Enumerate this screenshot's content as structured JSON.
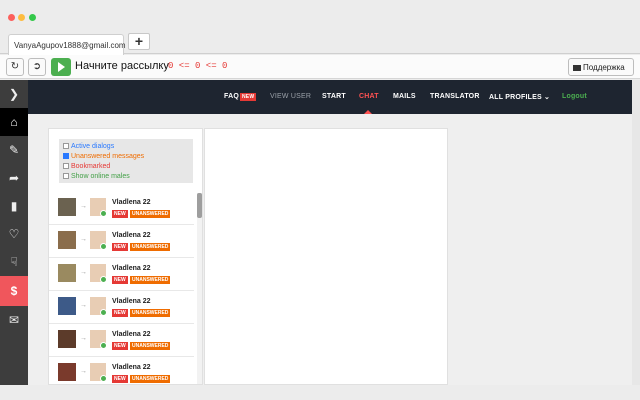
{
  "browser": {
    "tab_title": "VanyaAgupov1888@gmail.com",
    "new_tab_label": "+"
  },
  "toolbar": {
    "start_mailing_label": "Начните рассылку",
    "counter_text": "0 <= 0 <= 0",
    "support_label": "Поддержка"
  },
  "nav": {
    "faq": "FAQ",
    "faq_badge": "NEW",
    "view_user": "VIEW USER",
    "start": "START",
    "chat": "CHAT",
    "mails": "MAILS",
    "translator": "TRANSLATOR",
    "all_profiles": "ALL PROFILES",
    "logout": "Logout"
  },
  "filters": [
    {
      "label": "Active dialogs",
      "checked": false,
      "color": "#2979ff"
    },
    {
      "label": "Unanswered messages",
      "checked": true,
      "color": "#ef6c00"
    },
    {
      "label": "Bookmarked",
      "checked": false,
      "color": "#e53935"
    },
    {
      "label": "Show online males",
      "checked": false,
      "color": "#43a047"
    }
  ],
  "dialogs": [
    {
      "name": "Vladlena 22",
      "badge_new": "NEW",
      "badge_status": "UNANSWERED"
    },
    {
      "name": "Vladlena 22",
      "badge_new": "NEW",
      "badge_status": "UNANSWERED"
    },
    {
      "name": "Vladlena 22",
      "badge_new": "NEW",
      "badge_status": "UNANSWERED"
    },
    {
      "name": "Vladlena 22",
      "badge_new": "NEW",
      "badge_status": "UNANSWERED"
    },
    {
      "name": "Vladlena 22",
      "badge_new": "NEW",
      "badge_status": "UNANSWERED"
    },
    {
      "name": "Vladlena 22",
      "badge_new": "NEW",
      "badge_status": "UNANSWERED"
    }
  ],
  "sidebar_icons": [
    "chevron-right-icon",
    "home-icon",
    "edit-icon",
    "forward-icon",
    "chart-icon",
    "heart-icon",
    "thumbs-down-icon",
    "dollar-icon",
    "mail-icon"
  ],
  "colors": {
    "nav_bg": "#1e2530",
    "accent_red": "#ff5252",
    "dollar_bg": "#f0565c",
    "online": "#4caf50"
  }
}
